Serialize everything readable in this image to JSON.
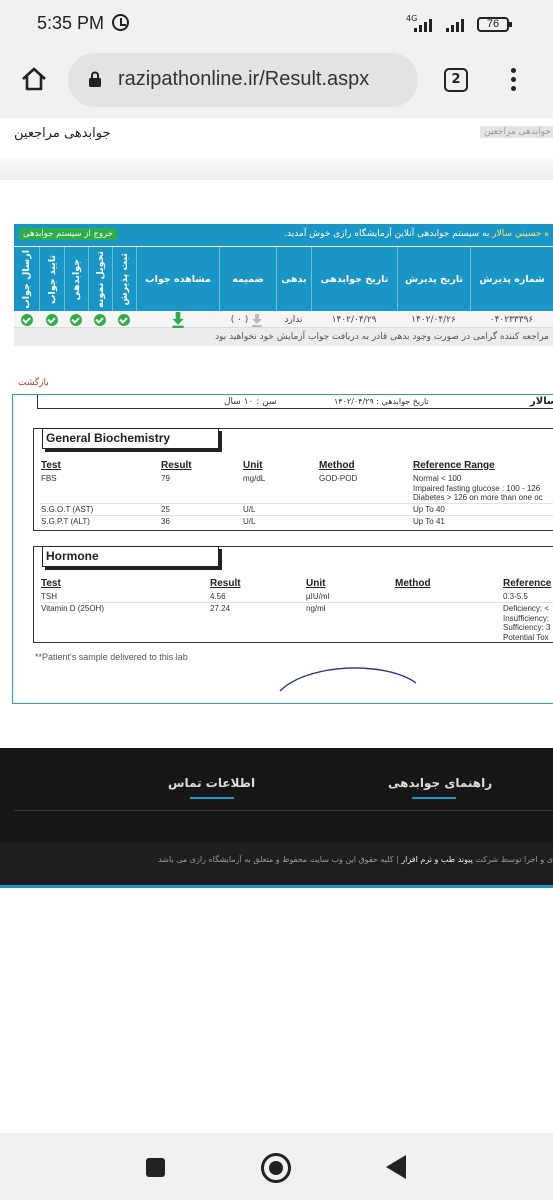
{
  "status_bar": {
    "time": "5:35 PM",
    "network": "4G",
    "battery": "76"
  },
  "browser": {
    "url": "razipathonline.ir/Result.aspx",
    "tab_count": "2"
  },
  "header": {
    "title": "جوابدهی مراجعین",
    "breadcrumb": "جوابدهی مراجعین"
  },
  "results": {
    "welcome_name": "ه حسيني سالار",
    "welcome_text": " به سیستم جوابدهی آنلاین آزمایشگاه رازی خوش آمدید.",
    "exit_label": "خروج از سیستم جوابدهی",
    "columns": {
      "reception_no": "شماره پذیرش",
      "reception_date": "تاریخ پذیرش",
      "response_date": "تاریخ جوابدهی",
      "debt": "بدهی",
      "attachment": "ضمیمه",
      "view_result": "مشاهده جواب",
      "register_reception": "ثبت پذیرش",
      "sample_delivery": "تحویل نمونه",
      "response": "جوابدهی",
      "confirm_response": "تایید جواب",
      "send_response": "ارسال جواب"
    },
    "row": {
      "reception_no": "۰۴۰۲۳۳۳۹۶",
      "reception_date": "۱۴۰۲/۰۴/۲۶",
      "response_date": "۱۴۰۲/۰۴/۲۹",
      "debt": "ندارد",
      "attachment_count": "( ۰ )"
    },
    "note": "مراجعه کننده گرامی در صورت وجود بدهی قادر به دریافت جواب آزمایش خود نخواهید بود"
  },
  "back_label": "بازگشت",
  "report": {
    "patient_name": "حسیني سالار",
    "report_date": "تاريخ جوابدهي : ۱۴۰۲/۰۴/۲۹",
    "age": "سن : ۱۰ سال",
    "biochem": {
      "title": "General Biochemistry",
      "headers": {
        "test": "Test",
        "result": "Result",
        "unit": "Unit",
        "method": "Method",
        "ref": "Reference Range"
      },
      "rows": [
        {
          "test": "FBS",
          "result": "79",
          "unit": "mg/dL",
          "method": "GOD-POD",
          "ref": [
            "Normal < 100",
            "Impaired fasting glucose : 100 - 126",
            "Diabetes > 126 on more than one oc"
          ]
        },
        {
          "test": "S.G.O.T (AST)",
          "result": "25",
          "unit": "U/L",
          "method": "",
          "ref": [
            "Up To 40"
          ]
        },
        {
          "test": "S.G.P.T (ALT)",
          "result": "36",
          "unit": "U/L",
          "method": "",
          "ref": [
            "Up To 41"
          ]
        }
      ]
    },
    "hormone": {
      "title": "Hormone",
      "headers": {
        "test": "Test",
        "result": "Result",
        "unit": "Unit",
        "method": "Method",
        "ref": "Reference"
      },
      "rows": [
        {
          "test": "TSH",
          "result": "4.56",
          "unit": "µIU/ml",
          "method": "",
          "ref": [
            "0.3-5.5"
          ]
        },
        {
          "test": "Vitamin D (25OH)",
          "result": "27.24",
          "unit": "ng/ml",
          "method": "",
          "ref": [
            "Deficiency: <",
            "Insufficiency:",
            "Sufficiency: 3",
            "Potential Tox"
          ]
        }
      ]
    },
    "footnote": "**Patient's sample delivered to this lab"
  },
  "footer": {
    "contact_title": "اطلاعات تماس",
    "guide_title": "راهنمای جوابدهی",
    "copyright_brand": "پیوند طب و نرم افزار",
    "copyright_prefix": "ی و اجرا توسط شرکت ",
    "copyright_suffix": " | کلیه حقوق این وب سایت محفوظ و متعلق به آزمایشگاه رازی می باشد"
  },
  "colors": {
    "accent": "#1a96c6",
    "success": "#2eae4a",
    "footer_bg": "#161616"
  }
}
